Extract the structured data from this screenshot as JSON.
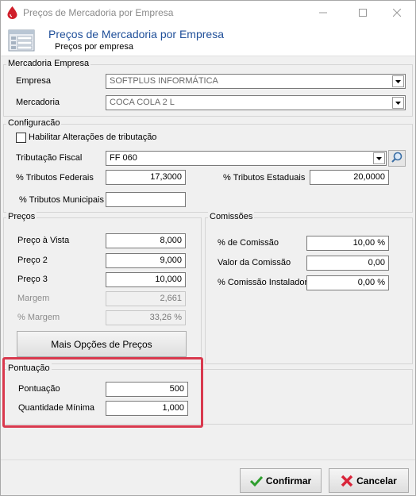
{
  "window": {
    "title": "Preços de Mercadoria por Empresa"
  },
  "header": {
    "title": "Preços de Mercadoria por Empresa",
    "subtitle": "Preços por empresa"
  },
  "mercadoria_empresa": {
    "legend": "Mercadoria Empresa",
    "empresa_label": "Empresa",
    "empresa_value": "SOFTPLUS INFORMÁTICA",
    "mercadoria_label": "Mercadoria",
    "mercadoria_value": "COCA COLA 2 L"
  },
  "configuracao": {
    "legend": "Configuracão",
    "habilitar_label": "Habilitar Alterações de tributação",
    "tributacao_label": "Tributação Fiscal",
    "tributacao_value": "FF 060",
    "federais_label": "% Tributos Federais",
    "federais_value": "17,3000",
    "estaduais_label": "% Tributos Estaduais",
    "estaduais_value": "20,0000",
    "municipais_label": "% Tributos Municipais",
    "municipais_value": ""
  },
  "precos": {
    "legend": "Preços",
    "vista_label": "Preço à Vista",
    "vista_value": "8,000",
    "p2_label": "Preço 2",
    "p2_value": "9,000",
    "p3_label": "Preço 3",
    "p3_value": "10,000",
    "margem_label": "Margem",
    "margem_value": "2,661",
    "pct_margem_label": "% Margem",
    "pct_margem_value": "33,26 %",
    "mais_opcoes": "Mais Opções de Preços"
  },
  "comissoes": {
    "legend": "Comissões",
    "pct_label": "% de Comissão",
    "pct_value": "10,00 %",
    "valor_label": "Valor da Comissão",
    "valor_value": "0,00",
    "instalador_label": "% Comissão Instalador",
    "instalador_value": "0,00 %"
  },
  "pontuacao": {
    "legend": "Pontuação",
    "pontuacao_label": "Pontuação",
    "pontuacao_value": "500",
    "qtd_label": "Quantidade Mínima",
    "qtd_value": "1,000"
  },
  "footer": {
    "confirmar": "Confirmar",
    "cancelar": "Cancelar"
  },
  "icons": [
    "app-drop-icon",
    "minimize-icon",
    "maximize-icon",
    "close-icon",
    "form-icon",
    "dropdown-arrow-icon",
    "search-icon",
    "check-icon",
    "cancel-x-icon"
  ],
  "colors": {
    "header_title": "#1f4f99",
    "highlight": "#d9394e",
    "check": "#2e9e2e",
    "cancel": "#d9253a"
  }
}
